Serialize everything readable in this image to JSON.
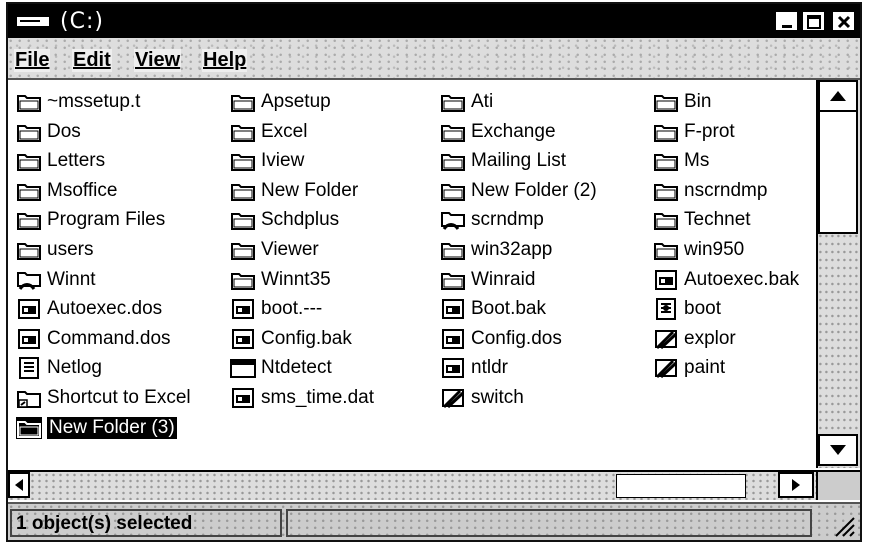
{
  "window": {
    "title": "(C:)"
  },
  "menu": [
    "File",
    "Edit",
    "View",
    "Help"
  ],
  "files": [
    {
      "name": "~mssetup.t",
      "icon": "folder-icon",
      "col": 0,
      "row": 0
    },
    {
      "name": "Apsetup",
      "icon": "folder-icon",
      "col": 1,
      "row": 0
    },
    {
      "name": "Ati",
      "icon": "folder-icon",
      "col": 2,
      "row": 0
    },
    {
      "name": "Bin",
      "icon": "folder-icon",
      "col": 3,
      "row": 0
    },
    {
      "name": "Dos",
      "icon": "folder-icon",
      "col": 0,
      "row": 1
    },
    {
      "name": "Excel",
      "icon": "folder-icon",
      "col": 1,
      "row": 1
    },
    {
      "name": "Exchange",
      "icon": "folder-icon",
      "col": 2,
      "row": 1
    },
    {
      "name": "F-prot",
      "icon": "folder-icon",
      "col": 3,
      "row": 1
    },
    {
      "name": "Letters",
      "icon": "folder-icon",
      "col": 0,
      "row": 2
    },
    {
      "name": "Iview",
      "icon": "folder-icon",
      "col": 1,
      "row": 2
    },
    {
      "name": "Mailing List",
      "icon": "folder-icon",
      "col": 2,
      "row": 2
    },
    {
      "name": "Ms",
      "icon": "folder-icon",
      "col": 3,
      "row": 2
    },
    {
      "name": "Msoffice",
      "icon": "folder-icon",
      "col": 0,
      "row": 3
    },
    {
      "name": "New Folder",
      "icon": "folder-icon",
      "col": 1,
      "row": 3
    },
    {
      "name": "New Folder (2)",
      "icon": "folder-icon",
      "col": 2,
      "row": 3
    },
    {
      "name": "nscrndmp",
      "icon": "folder-icon",
      "col": 3,
      "row": 3
    },
    {
      "name": "Program Files",
      "icon": "folder-icon",
      "col": 0,
      "row": 4
    },
    {
      "name": "Schdplus",
      "icon": "folder-icon",
      "col": 1,
      "row": 4
    },
    {
      "name": "scrndmp",
      "icon": "folder-shared-icon",
      "col": 2,
      "row": 4
    },
    {
      "name": "Technet",
      "icon": "folder-icon",
      "col": 3,
      "row": 4
    },
    {
      "name": "users",
      "icon": "folder-icon",
      "col": 0,
      "row": 5
    },
    {
      "name": "Viewer",
      "icon": "folder-icon",
      "col": 1,
      "row": 5
    },
    {
      "name": "win32app",
      "icon": "folder-icon",
      "col": 2,
      "row": 5
    },
    {
      "name": "win950",
      "icon": "folder-icon",
      "col": 3,
      "row": 5
    },
    {
      "name": "Winnt",
      "icon": "folder-shared-icon",
      "col": 0,
      "row": 6
    },
    {
      "name": "Winnt35",
      "icon": "folder-icon",
      "col": 1,
      "row": 6
    },
    {
      "name": "Winraid",
      "icon": "folder-icon",
      "col": 2,
      "row": 6
    },
    {
      "name": "Autoexec.bak",
      "icon": "file-icon",
      "col": 3,
      "row": 6
    },
    {
      "name": "Autoexec.dos",
      "icon": "file-icon",
      "col": 0,
      "row": 7
    },
    {
      "name": "boot.---",
      "icon": "file-icon",
      "col": 1,
      "row": 7
    },
    {
      "name": "Boot.bak",
      "icon": "file-icon",
      "col": 2,
      "row": 7
    },
    {
      "name": "boot",
      "icon": "settings-file-icon",
      "col": 3,
      "row": 7
    },
    {
      "name": "Command.dos",
      "icon": "file-icon",
      "col": 0,
      "row": 8
    },
    {
      "name": "Config.bak",
      "icon": "file-icon",
      "col": 1,
      "row": 8
    },
    {
      "name": "Config.dos",
      "icon": "file-icon",
      "col": 2,
      "row": 8
    },
    {
      "name": "explor",
      "icon": "program-icon",
      "col": 3,
      "row": 8
    },
    {
      "name": "Netlog",
      "icon": "text-file-icon",
      "col": 0,
      "row": 9
    },
    {
      "name": "Ntdetect",
      "icon": "application-icon",
      "col": 1,
      "row": 9
    },
    {
      "name": "ntldr",
      "icon": "file-icon",
      "col": 2,
      "row": 9
    },
    {
      "name": "paint",
      "icon": "program-icon",
      "col": 3,
      "row": 9
    },
    {
      "name": "Shortcut to Excel",
      "icon": "shortcut-icon",
      "col": 0,
      "row": 10
    },
    {
      "name": "sms_time.dat",
      "icon": "file-icon",
      "col": 1,
      "row": 10
    },
    {
      "name": "switch",
      "icon": "program-icon",
      "col": 2,
      "row": 10
    },
    {
      "name": "New Folder (3)",
      "icon": "folder-icon",
      "col": 0,
      "row": 11,
      "selected": true
    }
  ],
  "status": {
    "selection": "1 object(s) selected"
  }
}
